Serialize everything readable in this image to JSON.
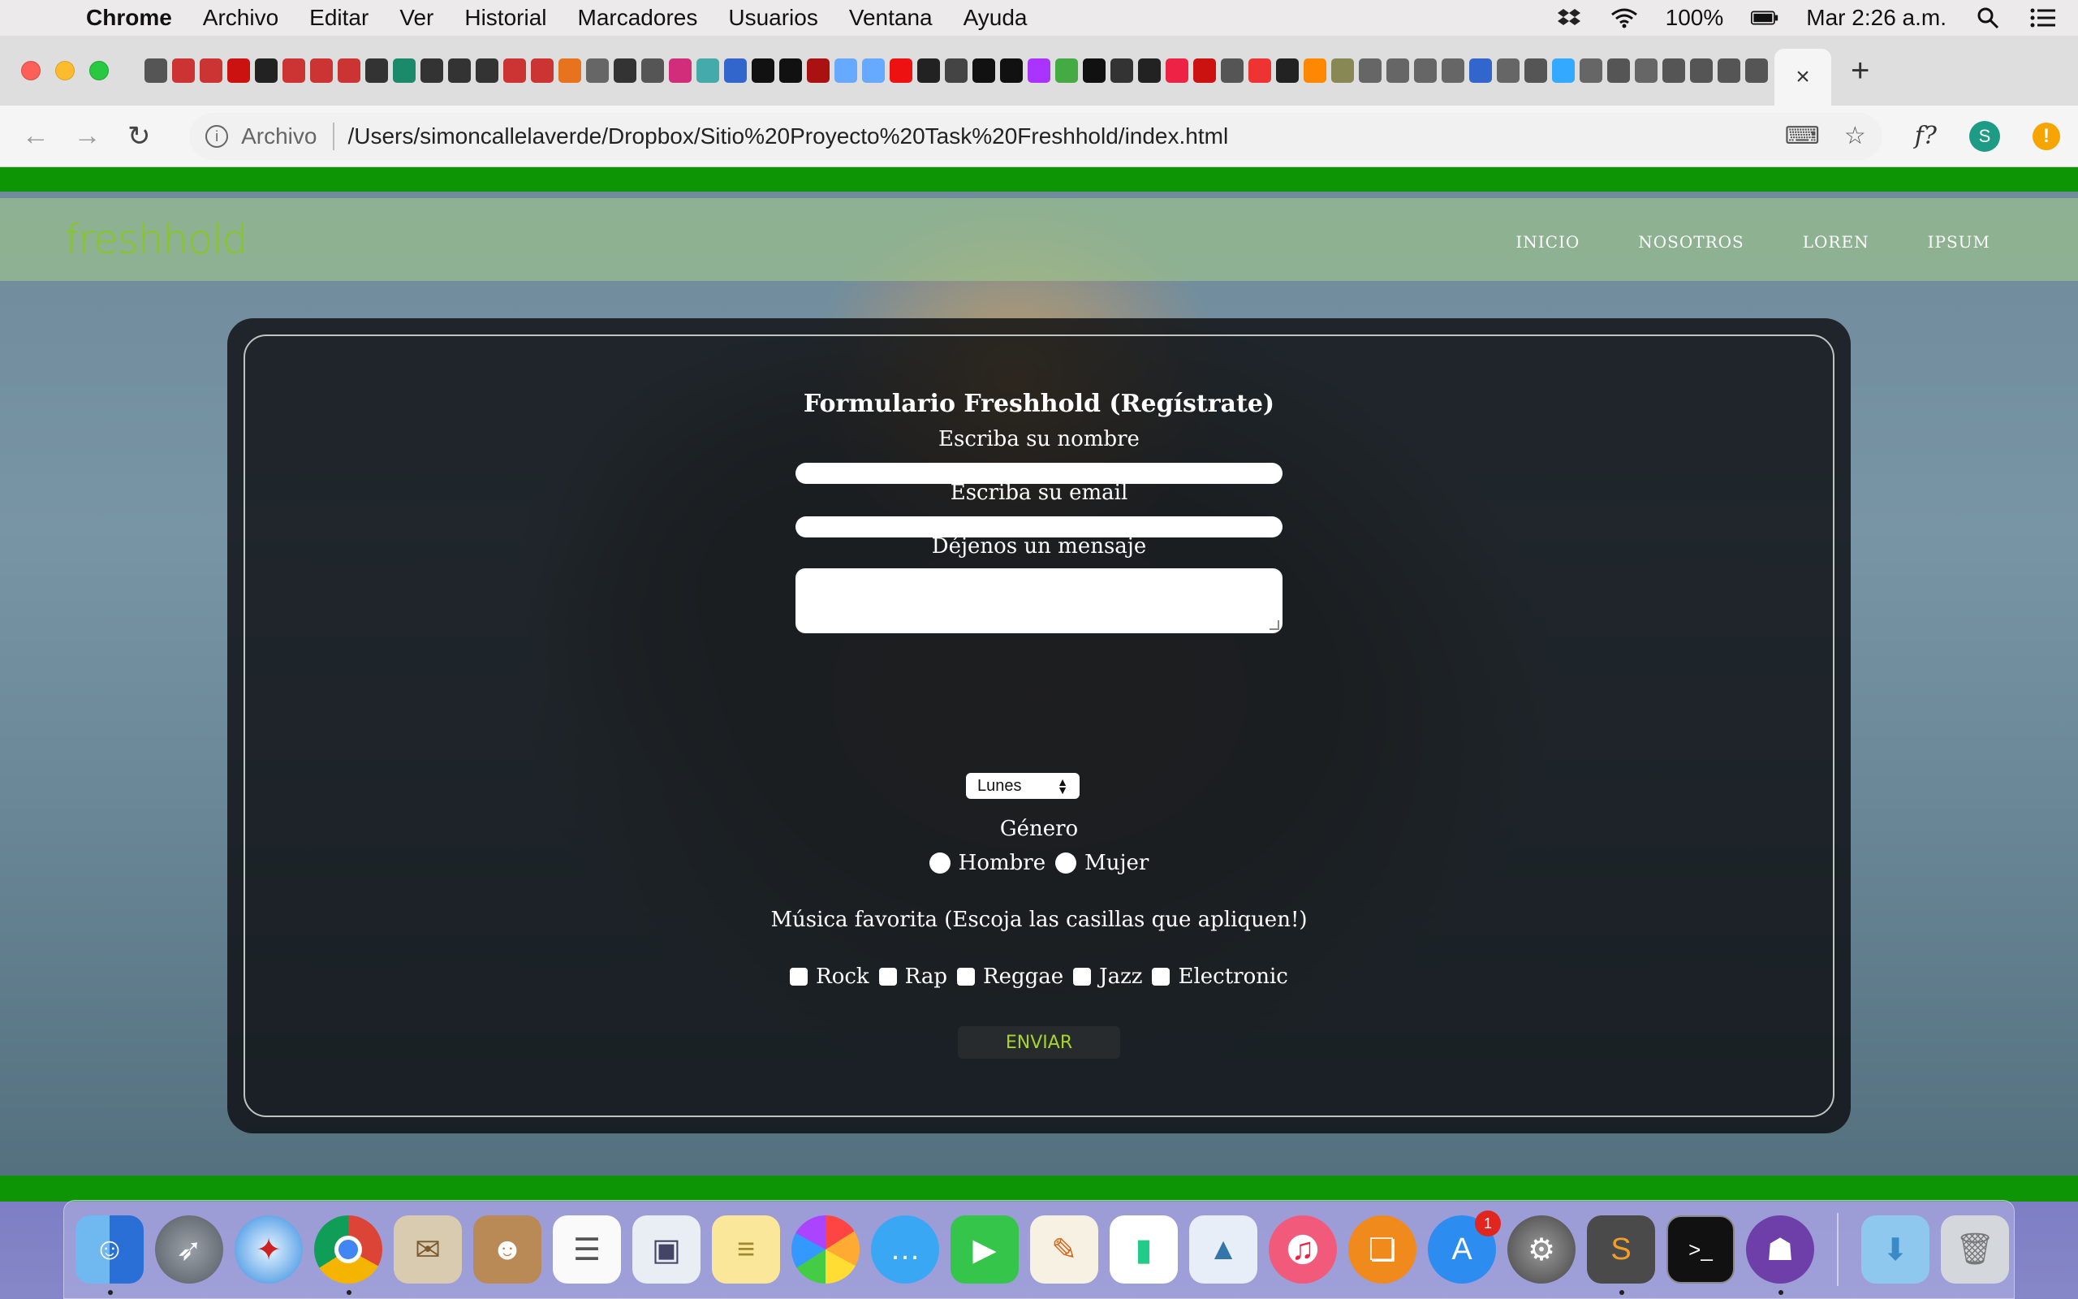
{
  "menubar": {
    "app": "Chrome",
    "items": [
      "Archivo",
      "Editar",
      "Ver",
      "Historial",
      "Marcadores",
      "Usuarios",
      "Ventana",
      "Ayuda"
    ],
    "battery": "100%",
    "clock": "Mar 2:26 a.m."
  },
  "browser": {
    "scheme_label": "Archivo",
    "url": "/Users/simoncallelaverde/Dropbox/Sitio%20Proyecto%20Task%20Freshhold/index.html",
    "fx_label": "f?",
    "avatar_letter": "S",
    "warning_glyph": "!",
    "active_tab_close": "×",
    "new_tab": "+"
  },
  "site": {
    "logo": "freshhold",
    "nav": [
      "INICIO",
      "NOSOTROS",
      "LOREN",
      "IPSUM"
    ]
  },
  "form": {
    "title": "Formulario Freshhold (Regístrate)",
    "name_label": "Escriba su nombre",
    "name_value": "",
    "email_label": "Escriba su email",
    "email_value": "",
    "message_label": "Déjenos un mensaje",
    "message_value": "",
    "day_selected": "Lunes",
    "gender_label": "Género",
    "gender_options": [
      "Hombre",
      "Mujer"
    ],
    "music_label": "Música favorita (Escoja las casillas que apliquen!)",
    "music_options": [
      "Rock",
      "Rap",
      "Reggae",
      "Jazz",
      "Electronic"
    ],
    "submit": "ENVIAR"
  },
  "dock": {
    "appstore_badge": "1"
  }
}
